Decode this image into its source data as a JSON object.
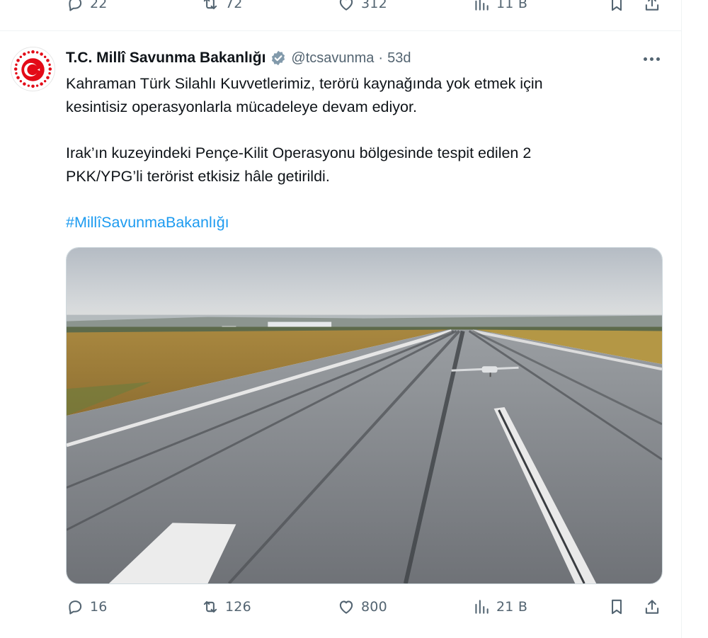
{
  "previous_tweet": {
    "actions": {
      "replies": "22",
      "retweets": "72",
      "likes": "312",
      "views": "11 B"
    }
  },
  "tweet": {
    "author": {
      "display_name": "T.C. Millî Savunma Bakanlığı",
      "handle": "@tcsavunma",
      "separator": "·",
      "time": "53d",
      "verified_badge_color": "#829aab"
    },
    "text": {
      "paragraph1_line1": "Kahraman Türk Silahlı Kuvvetlerimiz, terörü kaynağında yok etmek için",
      "paragraph1_line2": "kesintisiz operasyonlarla mücadeleye devam ediyor.",
      "paragraph2_line1": "Irak’ın kuzeyindeki Pençe-Kilit Operasyonu bölgesinde tespit edilen 2",
      "paragraph2_line2": "PKK/YPG’li terörist etkisiz hâle getirildi.",
      "hashtag": "#MillîSavunmaBakanlığı"
    },
    "actions": {
      "replies": "16",
      "retweets": "126",
      "likes": "800",
      "views": "21 B"
    }
  },
  "colors": {
    "text_primary": "#0f1419",
    "text_secondary": "#536471",
    "link": "#1d9bf0",
    "border": "#eff3f4",
    "emblem_red": "#e30a17"
  },
  "icons": [
    "reply-icon",
    "retweet-icon",
    "like-icon",
    "views-icon",
    "bookmark-icon",
    "share-icon",
    "more-icon",
    "verified-badge-icon"
  ]
}
